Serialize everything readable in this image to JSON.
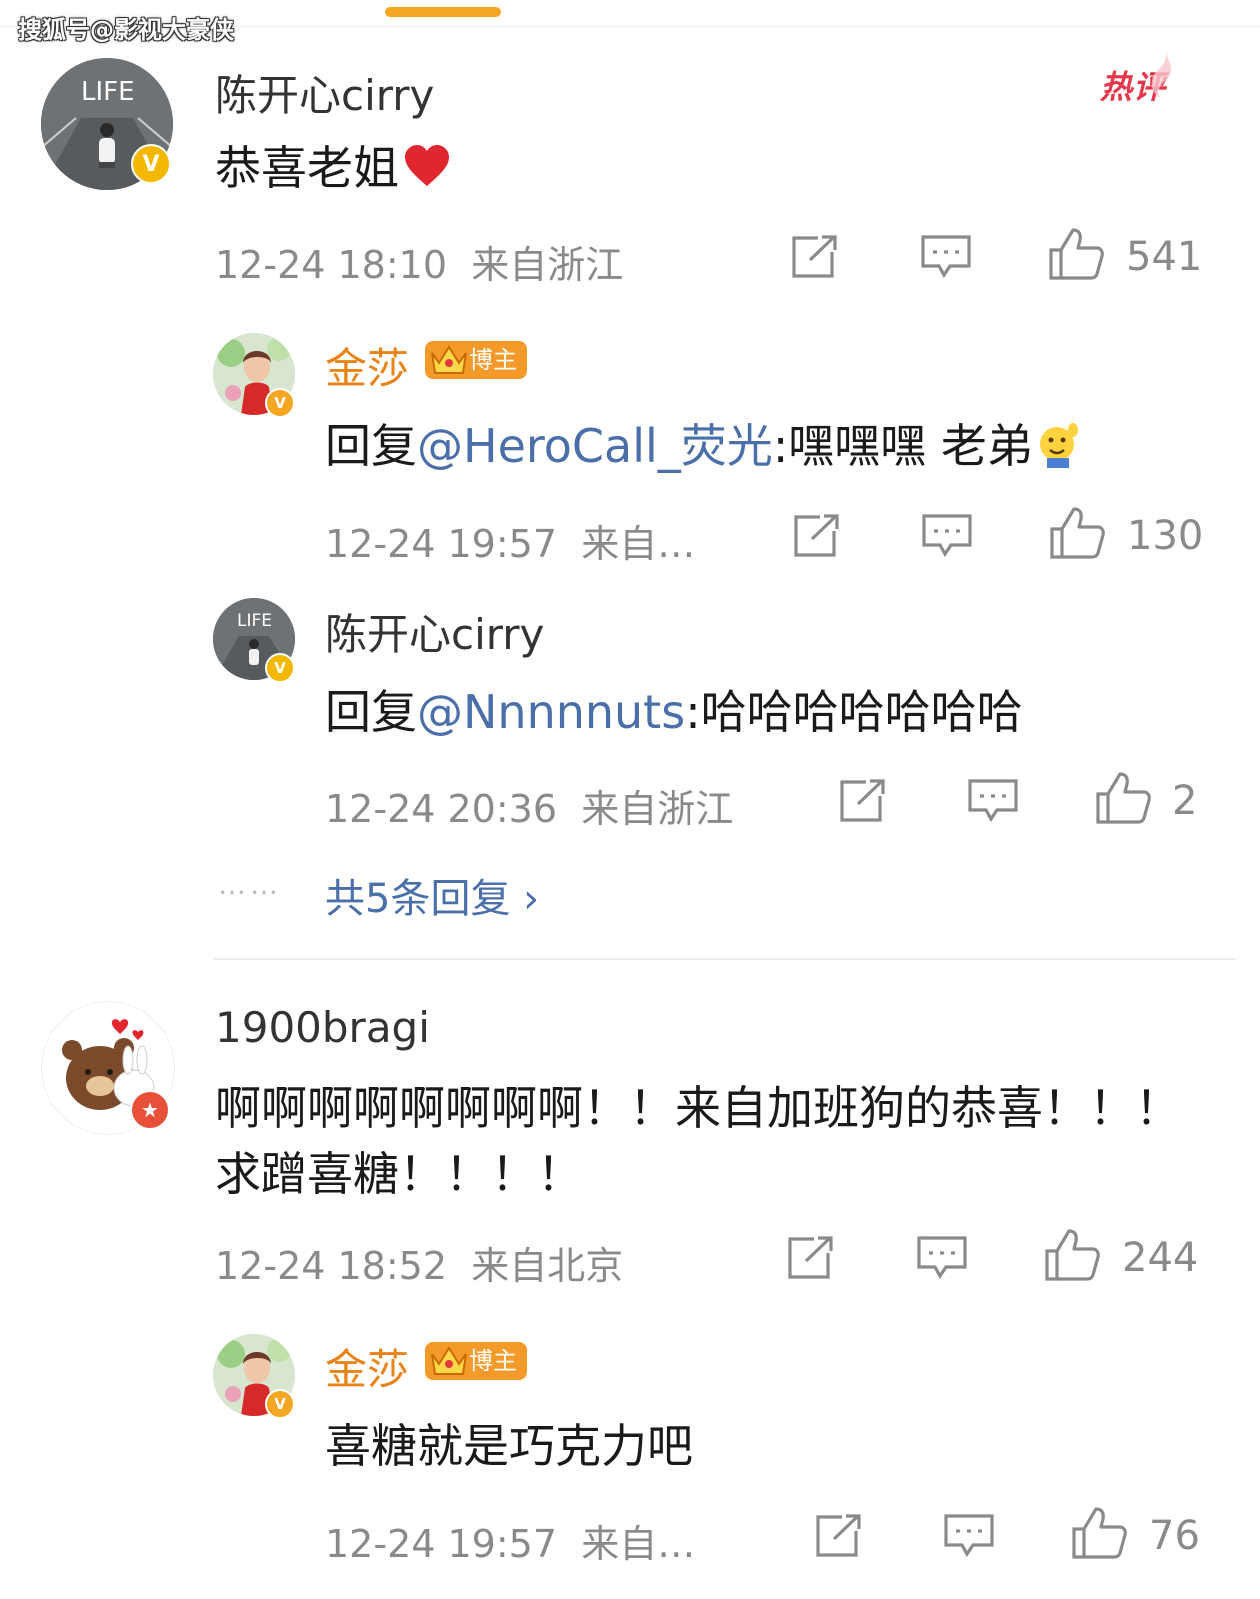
{
  "watermark": "搜狐号@影视大豪侠",
  "comments": [
    {
      "user": "陈开心cirry",
      "text": "恭喜老姐",
      "hot_badge": "热评",
      "time": "12-24 18:10",
      "location": "来自浙江",
      "likes": "541",
      "replies": [
        {
          "user": "金莎",
          "role_badge": "博主",
          "prefix": "回复",
          "mention": "@HeroCall_荧光",
          "text": ":嘿嘿嘿 老弟",
          "time": "12-24 19:57",
          "location": "来自…",
          "likes": "130"
        },
        {
          "user": "陈开心cirry",
          "prefix": "回复",
          "mention": "@Nnnnnuts",
          "text": ":哈哈哈哈哈哈哈",
          "time": "12-24 20:36",
          "location": "来自浙江",
          "likes": "2"
        }
      ],
      "more_dots": "……",
      "more_replies": "共5条回复 ›"
    },
    {
      "user": "1900bragi",
      "text_line1": "啊啊啊啊啊啊啊啊！！来自加班狗的恭喜！！！",
      "text_line2": "求蹭喜糖！！！！",
      "time": "12-24 18:52",
      "location": "来自北京",
      "likes": "244",
      "replies": [
        {
          "user": "金莎",
          "role_badge": "博主",
          "text": "喜糖就是巧克力吧",
          "time": "12-24 19:57",
          "location": "来自…",
          "likes": "76"
        }
      ]
    }
  ],
  "colors": {
    "mention": "#4b6fa8",
    "blogger_name": "#e8831a",
    "hot": "#e6374a",
    "meta": "#8a8a8a",
    "badge_gold": "#f5b800"
  },
  "icons": [
    "share-icon",
    "comment-icon",
    "like-icon",
    "heart-emoji",
    "waving-emoji",
    "crown-icon",
    "verified-icon"
  ]
}
